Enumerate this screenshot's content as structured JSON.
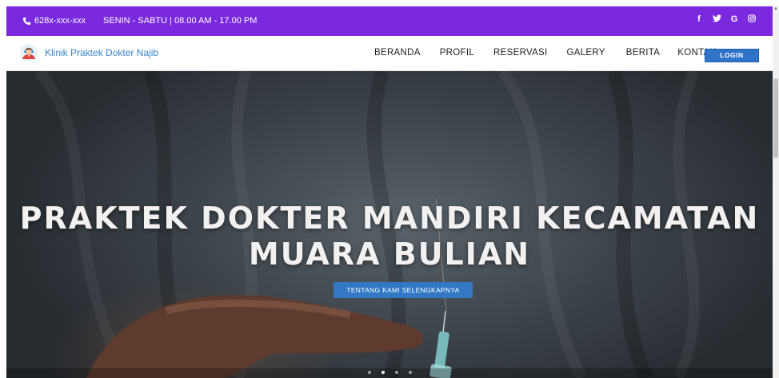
{
  "topbar": {
    "phone": "628x-xxx-xxx",
    "hours": "SENIN - SABTU | 08.00 AM - 17.00 PM",
    "socials": [
      {
        "icon": "facebook-icon",
        "glyph": "f"
      },
      {
        "icon": "twitter-icon",
        "glyph": "❱"
      },
      {
        "icon": "google-icon",
        "glyph": "G"
      },
      {
        "icon": "instagram-icon",
        "glyph": "◎"
      }
    ]
  },
  "navbar": {
    "brand_name": "Klinik Praktek Dokter Najib",
    "menu": [
      "BERANDA",
      "PROFIL",
      "RESERVASI",
      "GALERY",
      "BERITA",
      "KONTAK"
    ],
    "login_label": "LOGIN"
  },
  "hero": {
    "title_line1": "PRAKTEK DOKTER MANDIRI KECAMATAN",
    "title_line2": "MUARA BULIAN",
    "button_label": "TENTANG KAMI SELENGKAPNYA",
    "slide_count": 4,
    "active_slide": 2
  },
  "colors": {
    "topbar_bg": "#7a29df",
    "brand_text": "#3a86c8",
    "button_blue": "#2f74c9"
  }
}
